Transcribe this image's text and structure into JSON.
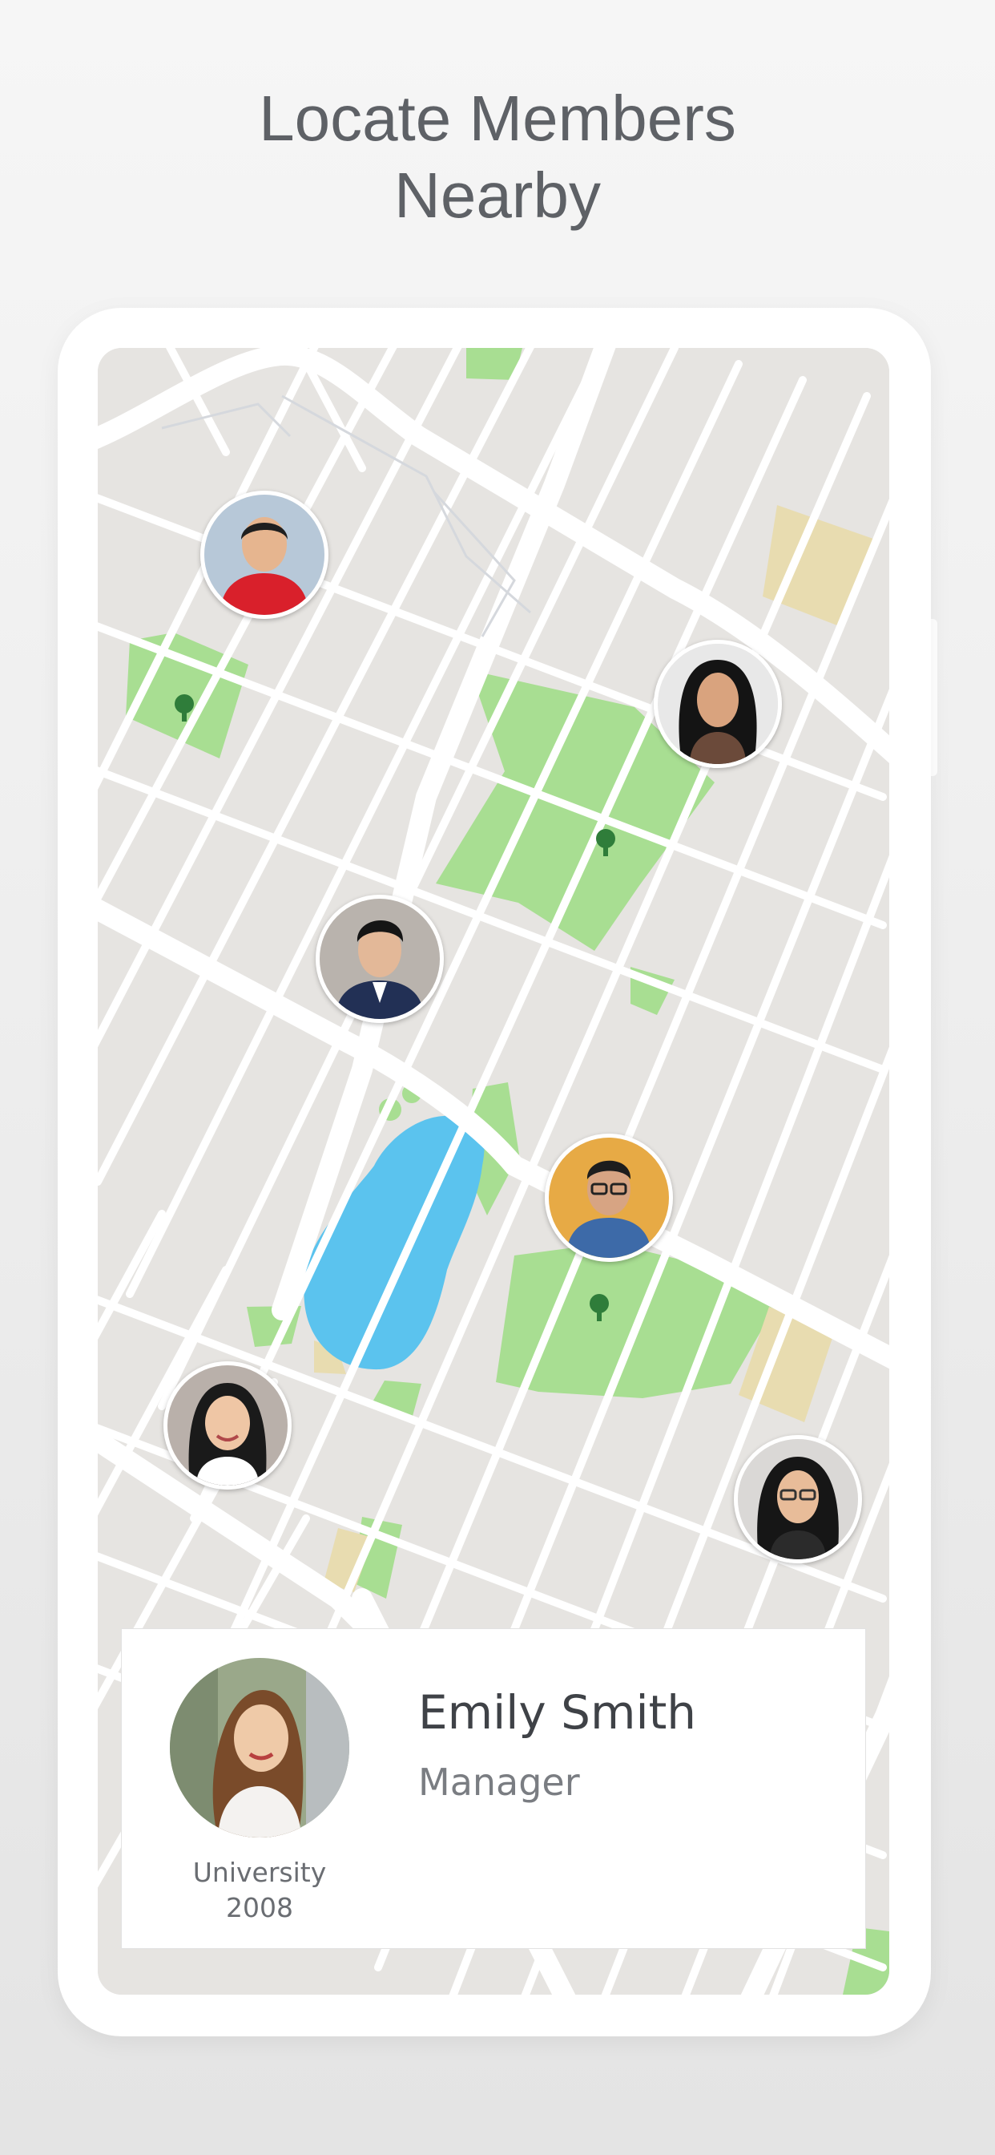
{
  "headline": {
    "line1": "Locate Members",
    "line2": "Nearby"
  },
  "map": {
    "colors": {
      "background": "#e6e4e1",
      "road": "#ffffff",
      "park": "#a8de92",
      "water": "#5bc3ee",
      "sand": "#e8dcb0",
      "tree": "#2f7d3a"
    },
    "member_pins": [
      {
        "name": "member-pin-1",
        "skin": "#e6b58f",
        "hair": "#1f1f1f",
        "shirt": "#d9202b",
        "bg": "#b7c8d8"
      },
      {
        "name": "member-pin-2",
        "skin": "#d9a37e",
        "hair": "#141414",
        "shirt": "#6b4a3a",
        "bg": "#e8e8e8"
      },
      {
        "name": "member-pin-3",
        "skin": "#e3b898",
        "hair": "#151515",
        "shirt": "#223055",
        "bg": "#b9b3ad"
      },
      {
        "name": "member-pin-4",
        "skin": "#d7a483",
        "hair": "#1d1d1d",
        "shirt": "#3d6aa8",
        "bg": "#e7aa45"
      },
      {
        "name": "member-pin-5",
        "skin": "#efc6a5",
        "hair": "#1a1a1a",
        "shirt": "#ffffff",
        "bg": "#b9b0aa"
      },
      {
        "name": "member-pin-6",
        "skin": "#e8bc99",
        "hair": "#161616",
        "shirt": "#2b2b2b",
        "bg": "#dad8d6"
      }
    ]
  },
  "member_card": {
    "name": "Emily Smith",
    "role": "Manager",
    "caption_line1": "University",
    "caption_line2": "2008",
    "photo": {
      "skin": "#efcaa8",
      "hair": "#7a4b2a",
      "shirt": "#f4f2f0",
      "bg": "#9aa88a"
    }
  }
}
